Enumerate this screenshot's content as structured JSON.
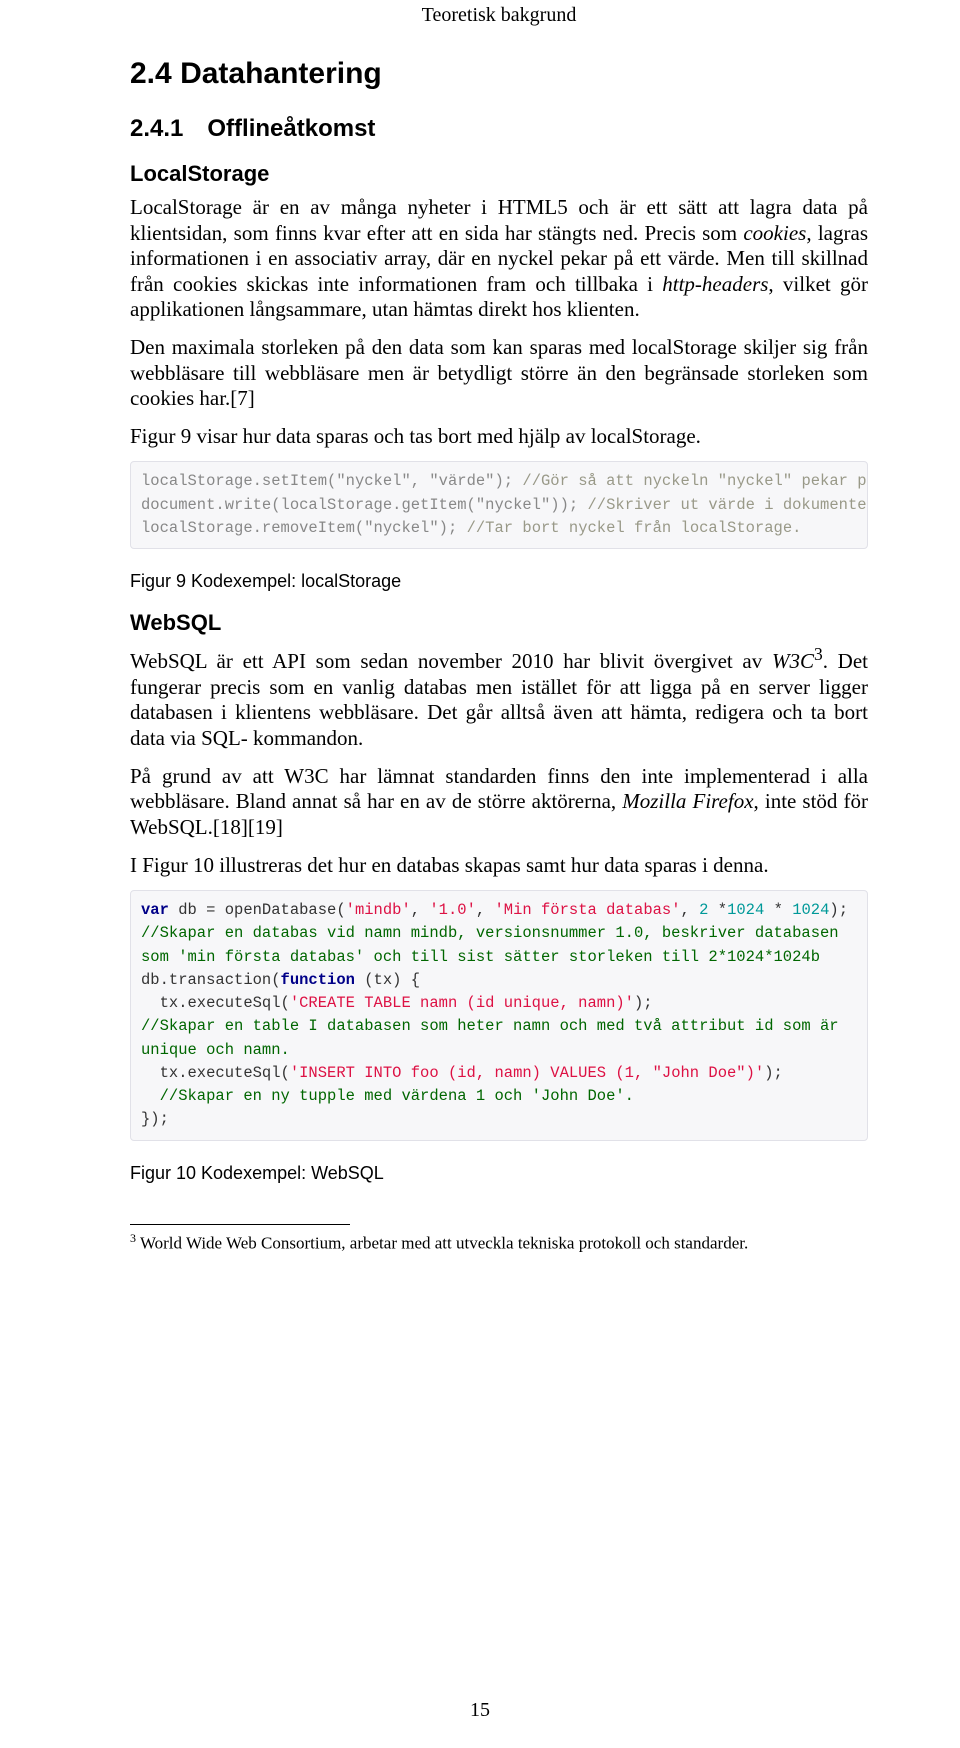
{
  "header": {
    "running_title": "Teoretisk bakgrund"
  },
  "sections": {
    "datahantering": {
      "num": "2.4",
      "title": "Datahantering"
    },
    "offline": {
      "num": "2.4.1",
      "title": "Offlineåtkomst"
    }
  },
  "localStorage": {
    "heading": "LocalStorage",
    "p1_a": "LocalStorage är en av många nyheter i HTML5 och är ett sätt att lagra data på klientsidan, som finns kvar efter att en sida har stängts ned. Precis som ",
    "p1_b": "cookies",
    "p1_c": ", lagras informationen i en associativ array, där en nyckel pekar på ett värde. Men till skillnad från cookies skickas inte informationen fram och tillbaka i ",
    "p1_d": "http-headers",
    "p1_e": ", vilket gör applikationen långsammare, utan hämtas direkt hos klienten.",
    "p2": "Den maximala storleken på den data som kan sparas med localStorage skiljer sig från webbläsare till webbläsare men är betydligt större än den begränsade storleken som cookies har.[7]",
    "p3": "Figur 9 visar hur data sparas och tas bort med hjälp av localStorage.",
    "code": {
      "l1a": "localStorage.setItem(",
      "l1b": "\"nyckel\"",
      "l1c": ", ",
      "l1d": "\"värde\"",
      "l1e": "); ",
      "l1f": "//Gör så att nyckeln \"nyckel\" pekar på värdet \"värde\".",
      "l2a": "document.write(localStorage.getItem(",
      "l2b": "\"nyckel\"",
      "l2c": ")); ",
      "l2d": "//Skriver ut värde i dokumentet.",
      "l3a": "localStorage.removeItem(",
      "l3b": "\"nyckel\"",
      "l3c": "); ",
      "l3d": "//Tar bort nyckel från localStorage."
    },
    "caption": "Figur 9 Kodexempel: localStorage"
  },
  "websql": {
    "heading": "WebSQL",
    "p1_a": "WebSQL är ett API som sedan november 2010 har blivit övergivet av ",
    "p1_b": "W3C",
    "p1_sup": "3",
    "p1_c": ". Det fungerar precis som en vanlig databas men istället för att ligga på en server ligger databasen i klientens webbläsare. Det går alltså även att hämta, redigera och ta bort data via SQL- kommandon.",
    "p2_a": "På grund av att W3C har lämnat standarden finns den inte implementerad i alla webbläsare. Bland annat så har en av de större aktörerna, ",
    "p2_b": "Mozilla Firefox",
    "p2_c": ", inte stöd för WebSQL.[18][19]",
    "p3": "I Figur 10 illustreras det hur en databas skapas samt hur data sparas i denna.",
    "code": {
      "l1a": "var",
      "l1b": " db = openDatabase(",
      "l1c": "'mindb'",
      "l1d": ", ",
      "l1e": "'1.0'",
      "l1f": ", ",
      "l1g": "'Min första databas'",
      "l1h": ", ",
      "l1i": "2",
      "l1j": " *",
      "l1k": "1024",
      "l1l": " *",
      "l1m": " 1024",
      "l1n": ");",
      "l2": "//Skapar en databas vid namn mindb, versionsnummer 1.0, beskriver databasen som 'min första databas' och till sist sätter storleken till 2*1024*1024b",
      "l3a": "db.transaction(",
      "l3b": "function",
      "l3c": " (tx) {",
      "l4a": "  tx.executeSql(",
      "l4b": "'CREATE TABLE namn (id unique, namn)'",
      "l4c": ");",
      "l5": "//Skapar en table I databasen som heter namn och med två attribut id som är unique och namn.",
      "l6a": "  tx.executeSql(",
      "l6b": "'INSERT INTO foo (id, namn) VALUES (1, \"John Doe\")'",
      "l6c": ");",
      "l7": "  //Skapar en ny tupple med värdena 1 och 'John Doe'.",
      "l8": "});"
    },
    "caption": "Figur 10 Kodexempel: WebSQL"
  },
  "footnote": {
    "num": "3",
    "text": " World Wide Web Consortium, arbetar med att utveckla tekniska protokoll och standarder."
  },
  "page_number": "15"
}
